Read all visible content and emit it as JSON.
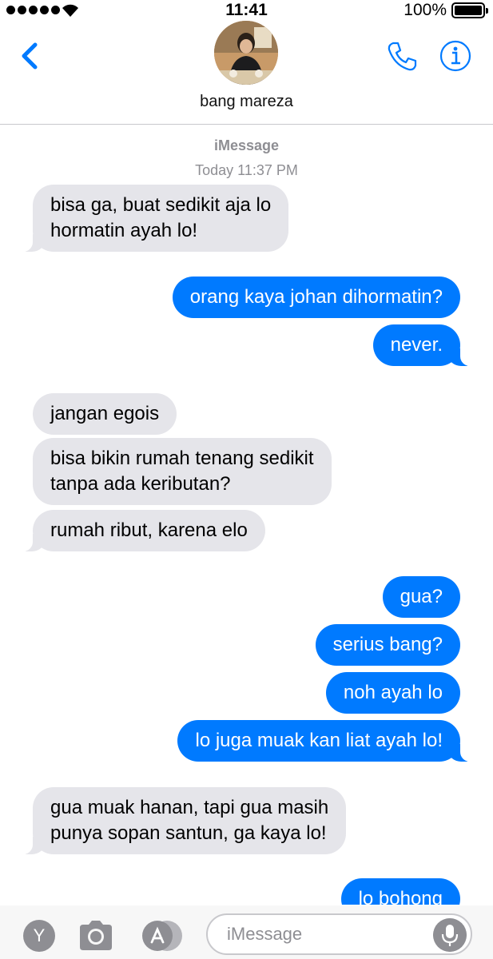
{
  "status_bar": {
    "time": "11:41",
    "battery": "100%"
  },
  "header": {
    "contact_name": "bang mareza",
    "icons": [
      "back-chevron-icon",
      "phone-icon",
      "info-icon"
    ]
  },
  "thread": {
    "service_label": "iMessage",
    "timestamp": "Today 11:37 PM",
    "messages": [
      {
        "side": "in",
        "text": "bisa ga, buat sedikit aja lo",
        "text2": "hormatin ayah lo!"
      },
      {
        "side": "out",
        "text": "orang kaya johan dihormatin?"
      },
      {
        "side": "out",
        "text": "never."
      },
      {
        "side": "in",
        "text": "jangan egois"
      },
      {
        "side": "in",
        "text": "bisa bikin rumah tenang sedikit",
        "text2": "tanpa ada keributan?"
      },
      {
        "side": "in",
        "text": "rumah ribut, karena elo"
      },
      {
        "side": "out",
        "text": "gua?"
      },
      {
        "side": "out",
        "text": "serius bang?"
      },
      {
        "side": "out",
        "text": "noh ayah lo"
      },
      {
        "side": "out",
        "text": "lo juga muak kan liat ayah lo!"
      },
      {
        "side": "in",
        "text": "gua muak hanan, tapi gua masih",
        "text2": "punya sopan santun, ga kaya lo!"
      },
      {
        "side": "out",
        "text": "lo bohong"
      }
    ]
  },
  "input_bar": {
    "app_button_label": "Y",
    "placeholder": "iMessage",
    "value": ""
  },
  "colors": {
    "accent": "#007aff",
    "incoming_bubble": "#e5e5ea",
    "muted": "#8e8e93"
  }
}
